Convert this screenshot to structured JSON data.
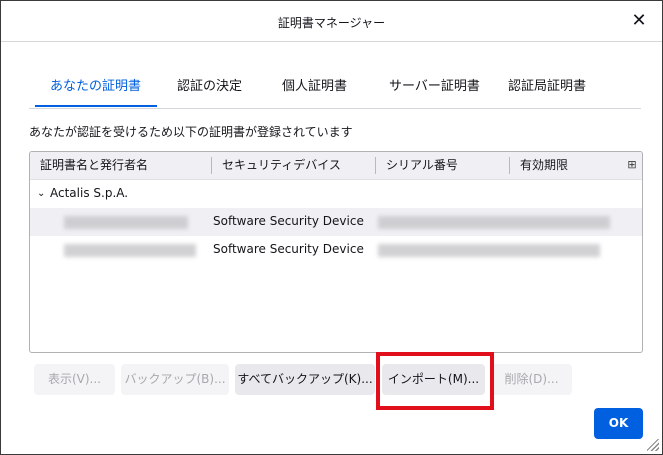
{
  "dialog": {
    "title": "証明書マネージャー",
    "close_glyph": "✕"
  },
  "tabs": [
    {
      "label": "あなたの証明書",
      "active": true
    },
    {
      "label": "認証の決定",
      "active": false
    },
    {
      "label": "個人証明書",
      "active": false
    },
    {
      "label": "サーバー証明書",
      "active": false
    },
    {
      "label": "認証局証明書",
      "active": false
    }
  ],
  "description": "あなたが認証を受けるため以下の証明書が登録されています",
  "tree": {
    "columns": [
      "証明書名と発行者名",
      "セキュリティデバイス",
      "シリアル番号",
      "有効期限"
    ],
    "column_picker_icon": "⊞",
    "group": {
      "twisty": "⌄",
      "label": "Actalis S.p.A."
    },
    "rows": [
      {
        "device": "Software Security Device"
      },
      {
        "device": "Software Security Device"
      }
    ]
  },
  "buttons": {
    "view": "表示(V)...",
    "backup": "バックアップ(B)...",
    "backup_all": "すべてバックアップ(K)...",
    "import": "インポート(M)...",
    "delete": "削除(D)...",
    "ok": "OK"
  },
  "colors": {
    "accent": "#0060df",
    "highlight": "#e00f1b"
  }
}
